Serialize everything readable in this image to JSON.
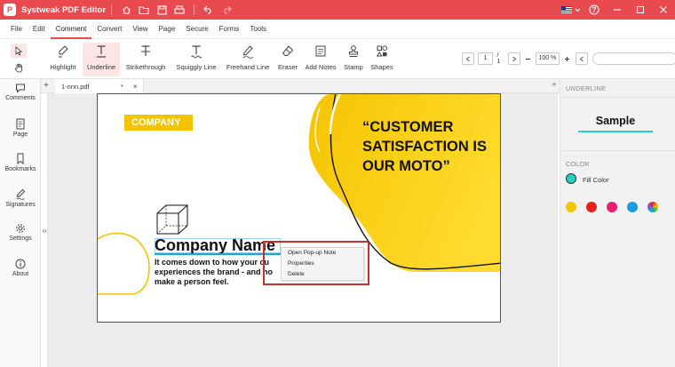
{
  "app": {
    "title": "Systweak PDF Editor",
    "logo_letter": "P"
  },
  "menu": [
    "File",
    "Edit",
    "Comment",
    "Convert",
    "View",
    "Page",
    "Secure",
    "Forms",
    "Tools"
  ],
  "active_menu": "Comment",
  "tools": [
    {
      "label": "Highlight",
      "icon": "highlight-pen-icon"
    },
    {
      "label": "Underline",
      "icon": "underline-icon"
    },
    {
      "label": "Strikethrough",
      "icon": "strikethrough-icon"
    },
    {
      "label": "Squiggly Line",
      "icon": "squiggly-icon"
    },
    {
      "label": "Freehand Line",
      "icon": "freehand-icon"
    },
    {
      "label": "Eraser",
      "icon": "eraser-icon"
    },
    {
      "label": "Add Notes",
      "icon": "note-icon"
    },
    {
      "label": "Stamp",
      "icon": "stamp-icon"
    },
    {
      "label": "Shapes",
      "icon": "shapes-icon"
    }
  ],
  "active_tool": "Underline",
  "pager": {
    "current_page": "1",
    "total": "/ 1",
    "zoom": "100 %"
  },
  "search": {
    "placeholder": ""
  },
  "sidebar": [
    {
      "label": "Comments",
      "icon": "comment-bubble-icon"
    },
    {
      "label": "Page",
      "icon": "page-icon"
    },
    {
      "label": "Bookmarks",
      "icon": "bookmark-icon"
    },
    {
      "label": "Signatures",
      "icon": "signature-pen-icon"
    },
    {
      "label": "Settings",
      "icon": "gear-icon"
    },
    {
      "label": "About",
      "icon": "info-icon"
    }
  ],
  "tab": {
    "name": "1-nnn.pdf",
    "modified": "*",
    "close": "×"
  },
  "document": {
    "badge": "COMPANY",
    "headline": "“CUSTOMER SATISFACTION IS OUR MOTO”",
    "company_name": "Company Name",
    "body_lines": [
      "It comes down to how your cu",
      "experiences the brand - and ho",
      "make a person feel."
    ]
  },
  "context_menu": [
    "Open Pop-up Note",
    "Properties",
    "Delete"
  ],
  "right_panel": {
    "header": "UNDERLINE",
    "sample": "Sample",
    "color_header": "COLOR",
    "fill_label": "Fill Color",
    "fill_color": "#20d3c2",
    "swatches": [
      "#f5c400",
      "#e82020",
      "#e8206e",
      "#1e9be0",
      "multicolor"
    ]
  },
  "colors": {
    "accent": "#e84a4f",
    "brand_yellow": "#f5c400"
  }
}
